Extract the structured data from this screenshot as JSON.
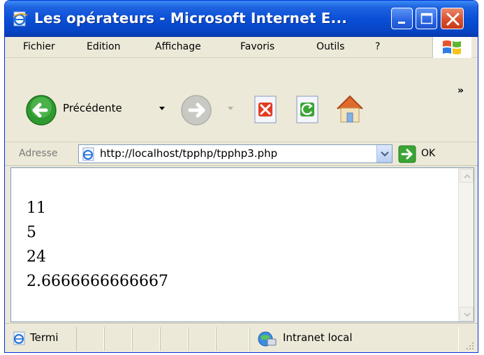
{
  "window": {
    "title": "Les opérateurs - Microsoft Internet E..."
  },
  "title_buttons": {
    "minimize_icon": "minimize-icon",
    "maximize_icon": "maximize-icon",
    "close_icon": "close-icon"
  },
  "menu": {
    "items": [
      {
        "label": "Fichier"
      },
      {
        "label": "Edition"
      },
      {
        "label": "Affichage"
      },
      {
        "label": "Favoris"
      },
      {
        "label": "Outils"
      },
      {
        "label": "?"
      }
    ]
  },
  "toolbar": {
    "back_label": "Précédente",
    "overflow": "»"
  },
  "address": {
    "label": "Adresse",
    "url": "http://localhost/tpphp/tpphp3.php",
    "go_label": "OK"
  },
  "content": {
    "lines": [
      "11",
      "5",
      "24",
      "2.6666666666667"
    ]
  },
  "status": {
    "left_text": "Termi",
    "zone_text": "Intranet local"
  },
  "colors": {
    "titlebar_blue": "#0a4fd6",
    "close_red": "#d9502c",
    "go_green": "#3aa534",
    "back_green": "#2f9a2f"
  }
}
